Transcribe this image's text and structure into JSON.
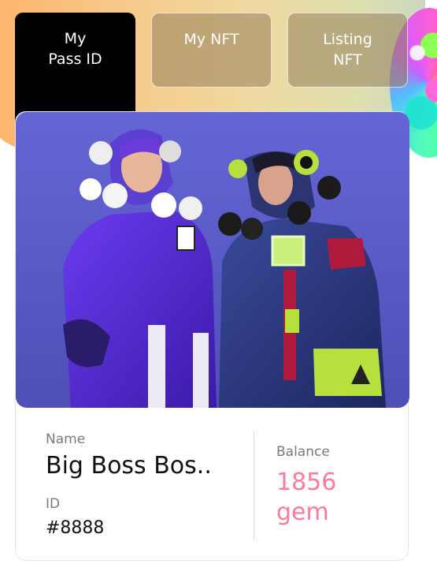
{
  "tabs": [
    {
      "label": "My\nPass ID",
      "active": true
    },
    {
      "label": "My NFT",
      "active": false
    },
    {
      "label": "Listing\nNFT",
      "active": false
    }
  ],
  "pass_card": {
    "image_alt": "two characters in puffer jackets",
    "name_label": "Name",
    "name_value": "Big Boss Bos..",
    "id_label": "ID",
    "id_value": "#8888",
    "balance_label": "Balance",
    "balance_amount": "1856",
    "balance_unit": "gem"
  },
  "colors": {
    "accent": "#ff7a9a",
    "active_tab": "#000000",
    "hero_bg": "#5a5cc6"
  }
}
